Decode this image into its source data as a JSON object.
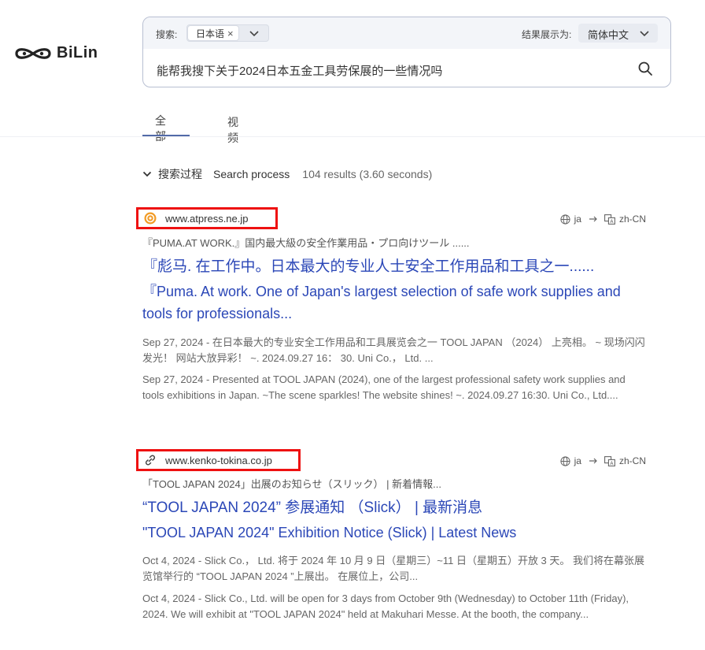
{
  "brand": {
    "name": "BiLin"
  },
  "search": {
    "label": "搜索:",
    "language_chip": "日本语",
    "result_lang_label": "结果展示为:",
    "result_lang": "简体中文",
    "query": "能帮我搜下关于2024日本五金工具劳保展的一些情况吗"
  },
  "tabs": [
    {
      "label": "全部",
      "active": true
    },
    {
      "label": "视频",
      "active": false
    }
  ],
  "process": {
    "label_zh": "搜索过程",
    "label_en": "Search process",
    "stats": "104 results  (3.60 seconds)"
  },
  "results": [
    {
      "domain": "www.atpress.ne.jp",
      "favicon": "atpress-icon",
      "trans_from": "ja",
      "trans_to": "zh-CN",
      "orig_title": "『PUMA.AT WORK.』国内最大級の安全作業用品・プロ向けツール ......",
      "title_zh": "『彪马. 在工作中。日本最大的专业人士安全工作用品和工具之一......",
      "title_en": "『Puma. At work. One of Japan's largest selection of safe work supplies and tools for professionals...",
      "snippet_zh": "Sep 27, 2024 - 在日本最大的专业安全工作用品和工具展览会之一 TOOL JAPAN （2024） 上亮相。 ~ 现场闪闪发光！ 网站大放异彩！ ~. 2024.09.27 16： 30. Uni Co.， Ltd. ...",
      "snippet_en": "Sep 27, 2024 - Presented at TOOL JAPAN (2024), one of the largest professional safety work supplies and tools exhibitions in Japan. ~The scene sparkles! The website shines! ~. 2024.09.27 16:30. Uni Co., Ltd...."
    },
    {
      "domain": "www.kenko-tokina.co.jp",
      "favicon": "link-icon",
      "trans_from": "ja",
      "trans_to": "zh-CN",
      "orig_title": "「TOOL JAPAN 2024」出展のお知らせ（スリック） | 新着情報...",
      "title_zh": "“TOOL JAPAN 2024” 参展通知 （Slick） | 最新消息",
      "title_en": "\"TOOL JAPAN 2024\" Exhibition Notice (Slick) | Latest News",
      "snippet_zh": "Oct 4, 2024 - Slick Co.， Ltd. 将于 2024 年 10 月 9 日（星期三）~11 日（星期五）开放 3 天。 我们将在幕张展览馆举行的 “TOOL JAPAN 2024 ”上展出。 在展位上，公司...",
      "snippet_en": "Oct 4, 2024 - Slick Co., Ltd. will be open for 3 days from October 9th (Wednesday) to October 11th (Friday), 2024. We will exhibit at \"TOOL JAPAN 2024\" held at Makuhari Messe. At the booth, the company..."
    }
  ]
}
